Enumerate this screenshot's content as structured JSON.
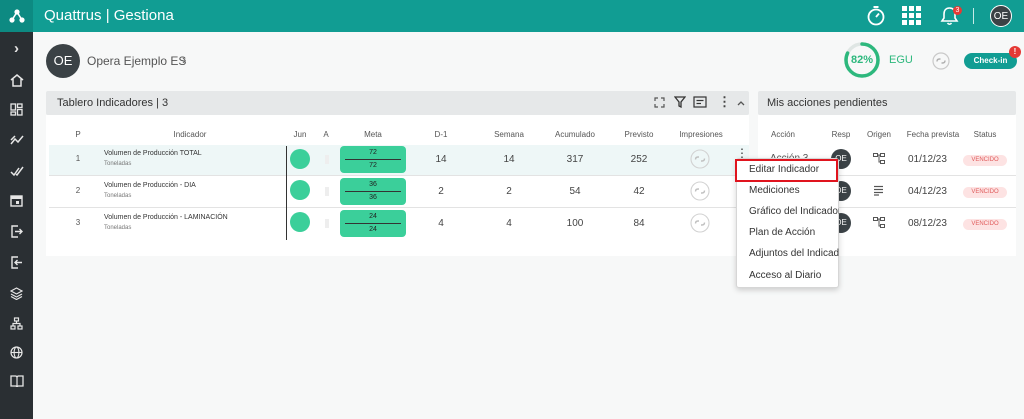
{
  "app": {
    "title": "Quattrus | Gestiona"
  },
  "topbar": {
    "notification_count": "3",
    "user_initials": "OE"
  },
  "sidebar": {
    "icons": [
      "chevron-right-icon",
      "home-icon",
      "dashboard-icon",
      "trend-icon",
      "check-icon",
      "calendar-icon",
      "export-icon",
      "import-icon",
      "layers-icon",
      "org-chart-icon",
      "globe-icon",
      "book-icon"
    ]
  },
  "org": {
    "initials": "OE",
    "name": "Opera Ejemplo ES"
  },
  "score": {
    "percent": "82%",
    "percent_value": 82,
    "label": "EGU"
  },
  "checkin": {
    "label": "Check-in",
    "badge": "!"
  },
  "indicators_panel": {
    "title": "Tablero Indicadores | 3",
    "columns": {
      "p": "P",
      "indicator": "Indicador",
      "jun": "Jun",
      "a": "A",
      "meta": "Meta",
      "d1": "D-1",
      "semana": "Semana",
      "acumulado": "Acumulado",
      "previsto": "Previsto",
      "impresiones": "Impresiones"
    },
    "rows": [
      {
        "p": "1",
        "name": "Volumen de Producción TOTAL",
        "unit": "Toneladas",
        "meta_top": "72",
        "meta_bottom": "72",
        "d1": "14",
        "semana": "14",
        "acumulado": "317",
        "previsto": "252"
      },
      {
        "p": "2",
        "name": "Volumen de Producción - DIA",
        "unit": "Toneladas",
        "meta_top": "36",
        "meta_bottom": "36",
        "d1": "2",
        "semana": "2",
        "acumulado": "54",
        "previsto": "42"
      },
      {
        "p": "3",
        "name": "Volumen de Producción - LAMINACIÓN",
        "unit": "Toneladas",
        "meta_top": "24",
        "meta_bottom": "24",
        "d1": "4",
        "semana": "4",
        "acumulado": "100",
        "previsto": "84"
      }
    ]
  },
  "actions_panel": {
    "title": "Mis acciones pendientes",
    "columns": {
      "accion": "Acción",
      "resp": "Resp",
      "origen": "Origen",
      "fecha": "Fecha prevista",
      "status": "Status"
    },
    "rows": [
      {
        "accion": "Acción 3",
        "resp": "OE",
        "fecha": "01/12/23",
        "status": "VENCIDO"
      },
      {
        "accion": "",
        "resp": "OE",
        "fecha": "04/12/23",
        "status": "VENCIDO"
      },
      {
        "accion": "",
        "resp": "OE",
        "fecha": "08/12/23",
        "status": "VENCIDO"
      }
    ]
  },
  "context_menu": {
    "items": [
      "Editar Indicador",
      "Mediciones",
      "Gráfico del Indicador",
      "Plan de Acción",
      "Adjuntos del Indicador",
      "Acceso al Diario"
    ]
  },
  "colors": {
    "brand": "#119d93",
    "sidebar": "#2a2f33",
    "green": "#3bcf9a",
    "score": "#2db87d",
    "alert": "#e53935",
    "highlight": "#e0141e"
  }
}
